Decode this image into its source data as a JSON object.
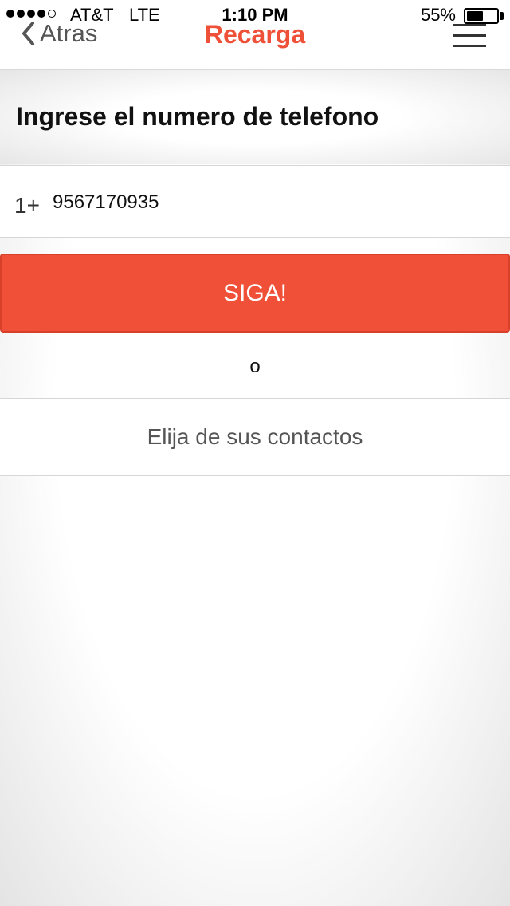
{
  "status_bar": {
    "carrier": "AT&T",
    "network": "LTE",
    "time": "1:10 PM",
    "battery_percent": "55%",
    "battery_level": 0.55,
    "signal_bars_filled": 4,
    "signal_bars_total": 5
  },
  "nav": {
    "back_label": "Atras",
    "title": "Recarga",
    "title_color": "#ef5138"
  },
  "main": {
    "heading": "Ingrese el numero de telefono",
    "phone_prefix": "1+",
    "phone_value": "9567170935",
    "continue_label": "SIGA!",
    "continue_color": "#f05038",
    "or_label": "o",
    "contacts_label": "Elija de sus contactos"
  },
  "icons": {
    "back": "chevron-left-icon",
    "menu": "hamburger-menu-icon",
    "battery": "battery-icon"
  }
}
